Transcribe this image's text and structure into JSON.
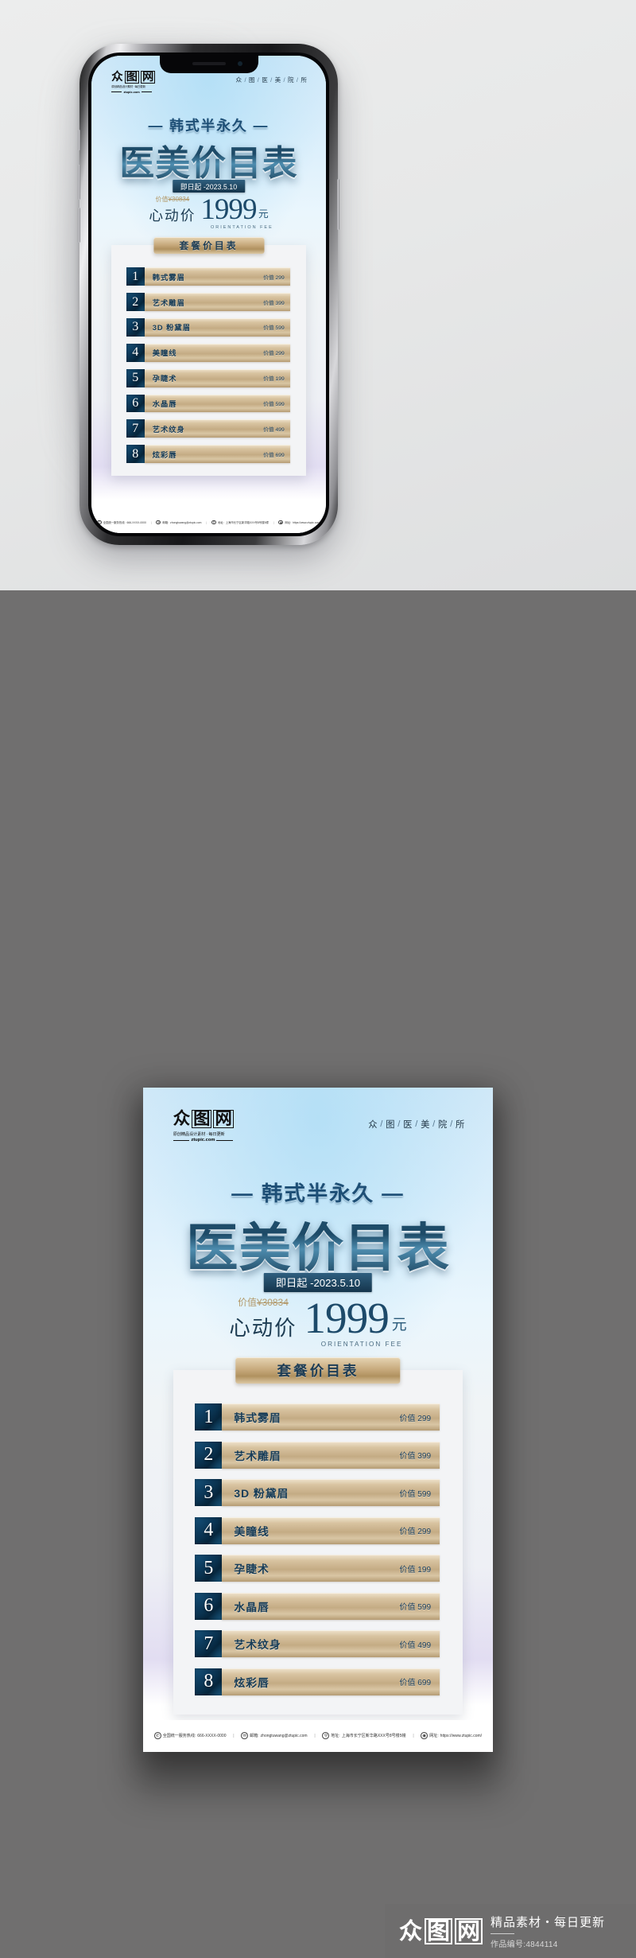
{
  "poster": {
    "watermark": {
      "glyph1": "众",
      "glyph2": "图",
      "glyph3": "网",
      "tagline": "原创精品设计素材 · 每日更新",
      "domain": "ztupic.com"
    },
    "nav": {
      "items": [
        "众",
        "图",
        "医",
        "美",
        "院",
        "所"
      ],
      "separator": "/"
    },
    "sub_title": "— 韩式半永久 —",
    "main_title": "医美价目表",
    "date_banner": "即日起 -2023.5.10",
    "price": {
      "original_label": "价值",
      "original_value": "¥30834",
      "heart_label": "心动价",
      "amount": "1999",
      "unit": "元",
      "english": "ORIENTATION FEE"
    },
    "card_title": "套餐价目表",
    "rows": [
      {
        "num": "1",
        "name": "韩式雾眉",
        "price_label": "价值",
        "price": "299"
      },
      {
        "num": "2",
        "name": "艺术雕眉",
        "price_label": "价值",
        "price": "399"
      },
      {
        "num": "3",
        "name": "3D 粉黛眉",
        "price_label": "价值",
        "price": "599"
      },
      {
        "num": "4",
        "name": "美瞳线",
        "price_label": "价值",
        "price": "299"
      },
      {
        "num": "5",
        "name": "孕睫术",
        "price_label": "价值",
        "price": "199"
      },
      {
        "num": "6",
        "name": "水晶唇",
        "price_label": "价值",
        "price": "599"
      },
      {
        "num": "7",
        "name": "艺术纹身",
        "price_label": "价值",
        "price": "499"
      },
      {
        "num": "8",
        "name": "炫彩唇",
        "price_label": "价值",
        "price": "699"
      }
    ],
    "footer": {
      "phone_label": "全国统一服务热线:",
      "phone": "666-XXXX-0000",
      "email_label": "邮箱:",
      "email": "zhongtuwang@ztupic.com",
      "address_label": "地址:",
      "address": "上海市长宁区新华路XXX号8号楼5幢",
      "site_label": "网址:",
      "site": "https://www.ztupic.com/"
    }
  },
  "brandbar": {
    "glyph1": "众",
    "glyph2": "图",
    "glyph3": "网",
    "title": "精品素材・每日更新",
    "id_text": "作品编号:4844114"
  },
  "colors": {
    "poster_top": "#cfe8f8",
    "poster_bottom": "#ffffff",
    "accent_gold": "#c8ab7e",
    "accent_blue": "#17384f",
    "dark_bg": "#706f6f",
    "light_bg": "#eceded"
  }
}
